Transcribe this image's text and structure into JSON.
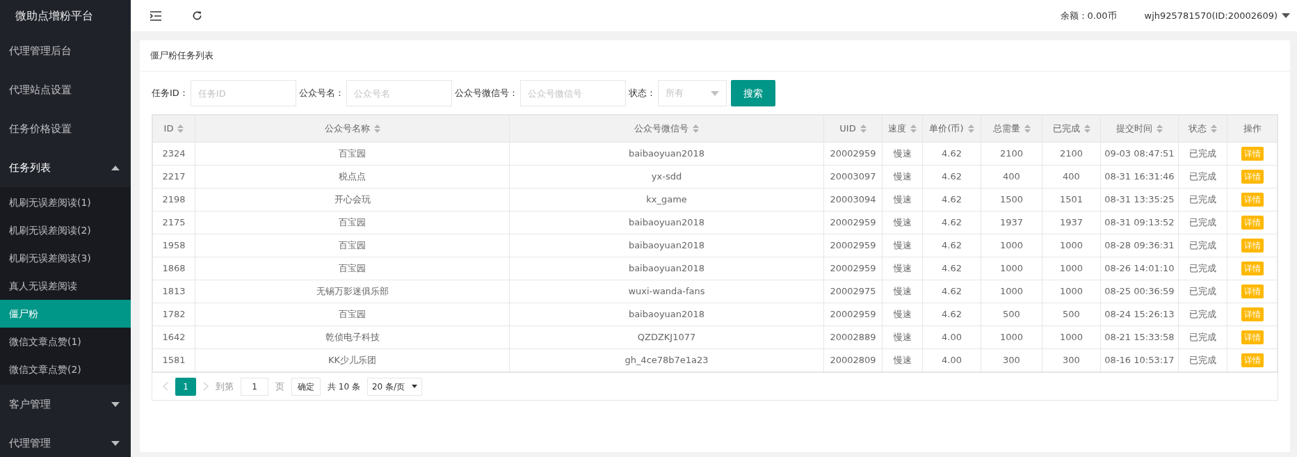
{
  "sidebar": {
    "brand": "微助点增粉平台",
    "items": [
      {
        "label": "代理管理后台",
        "expanded": false,
        "has_children": false
      },
      {
        "label": "代理站点设置",
        "expanded": false,
        "has_children": false
      },
      {
        "label": "任务价格设置",
        "expanded": false,
        "has_children": false
      },
      {
        "label": "任务列表",
        "expanded": true,
        "has_children": true,
        "children": [
          {
            "label": "机刷无误差阅读(1)",
            "selected": false
          },
          {
            "label": "机刷无误差阅读(2)",
            "selected": false
          },
          {
            "label": "机刷无误差阅读(3)",
            "selected": false
          },
          {
            "label": "真人无误差阅读",
            "selected": false
          },
          {
            "label": "僵尸粉",
            "selected": true
          },
          {
            "label": "微信文章点赞(1)",
            "selected": false
          },
          {
            "label": "微信文章点赞(2)",
            "selected": false
          }
        ]
      },
      {
        "label": "客户管理",
        "expanded": false,
        "has_children": true
      },
      {
        "label": "代理管理",
        "expanded": false,
        "has_children": true
      }
    ]
  },
  "topbar": {
    "balance": "余额：0.00币",
    "user": "wjh925781570(ID:20002609)"
  },
  "card": {
    "title": "僵尸粉任务列表",
    "filters": [
      {
        "kind": "input",
        "label": "任务ID：",
        "placeholder": "任务ID"
      },
      {
        "kind": "input",
        "label": "公众号名：",
        "placeholder": "公众号名"
      },
      {
        "kind": "input",
        "label": "公众号微信号：",
        "placeholder": "公众号微信号"
      },
      {
        "kind": "select",
        "label": "状态：",
        "placeholder": "所有"
      }
    ],
    "search_button": "搜索",
    "table": {
      "columns": [
        {
          "label": "ID",
          "sortable": true
        },
        {
          "label": "公众号名称",
          "sortable": true
        },
        {
          "label": "公众号微信号",
          "sortable": true
        },
        {
          "label": "UID",
          "sortable": true
        },
        {
          "label": "速度",
          "sortable": true
        },
        {
          "label": "单价(币)",
          "sortable": true
        },
        {
          "label": "总需量",
          "sortable": true
        },
        {
          "label": "已完成",
          "sortable": true
        },
        {
          "label": "提交时间",
          "sortable": true
        },
        {
          "label": "状态",
          "sortable": true
        },
        {
          "label": "操作",
          "sortable": false
        }
      ],
      "rows": [
        [
          "2324",
          "百宝园",
          "baibaoyuan2018",
          "20002959",
          "慢速",
          "4.62",
          "2100",
          "2100",
          "09-03 08:47:51",
          "已完成",
          "详情"
        ],
        [
          "2217",
          "税点点",
          "yx-sdd",
          "20003097",
          "慢速",
          "4.62",
          "400",
          "400",
          "08-31 16:31:46",
          "已完成",
          "详情"
        ],
        [
          "2198",
          "开心会玩",
          "kx_game",
          "20003094",
          "慢速",
          "4.62",
          "1500",
          "1501",
          "08-31 13:35:25",
          "已完成",
          "详情"
        ],
        [
          "2175",
          "百宝园",
          "baibaoyuan2018",
          "20002959",
          "慢速",
          "4.62",
          "1937",
          "1937",
          "08-31 09:13:52",
          "已完成",
          "详情"
        ],
        [
          "1958",
          "百宝园",
          "baibaoyuan2018",
          "20002959",
          "慢速",
          "4.62",
          "1000",
          "1000",
          "08-28 09:36:31",
          "已完成",
          "详情"
        ],
        [
          "1868",
          "百宝园",
          "baibaoyuan2018",
          "20002959",
          "慢速",
          "4.62",
          "1000",
          "1000",
          "08-26 14:01:10",
          "已完成",
          "详情"
        ],
        [
          "1813",
          "无锡万影迷俱乐部",
          "wuxi-wanda-fans",
          "20002975",
          "慢速",
          "4.62",
          "1000",
          "1000",
          "08-25 00:36:59",
          "已完成",
          "详情"
        ],
        [
          "1782",
          "百宝园",
          "baibaoyuan2018",
          "20002959",
          "慢速",
          "4.62",
          "500",
          "500",
          "08-24 15:26:13",
          "已完成",
          "详情"
        ],
        [
          "1642",
          "乾侦电子科技",
          "QZDZKJ1077",
          "20002889",
          "慢速",
          "4.00",
          "1000",
          "1000",
          "08-21 15:33:58",
          "已完成",
          "详情"
        ],
        [
          "1581",
          "KK少儿乐团",
          "gh_4ce78b7e1a23",
          "20002809",
          "慢速",
          "4.00",
          "300",
          "300",
          "08-16 10:53:17",
          "已完成",
          "详情"
        ]
      ]
    },
    "pagination": {
      "pages": [
        {
          "label": "1",
          "selected": true
        }
      ],
      "goto_label": "到第",
      "goto_value": "1",
      "page_unit": "页",
      "confirm": "确定",
      "total": "共 10 条",
      "page_size": "20 条/页"
    }
  }
}
